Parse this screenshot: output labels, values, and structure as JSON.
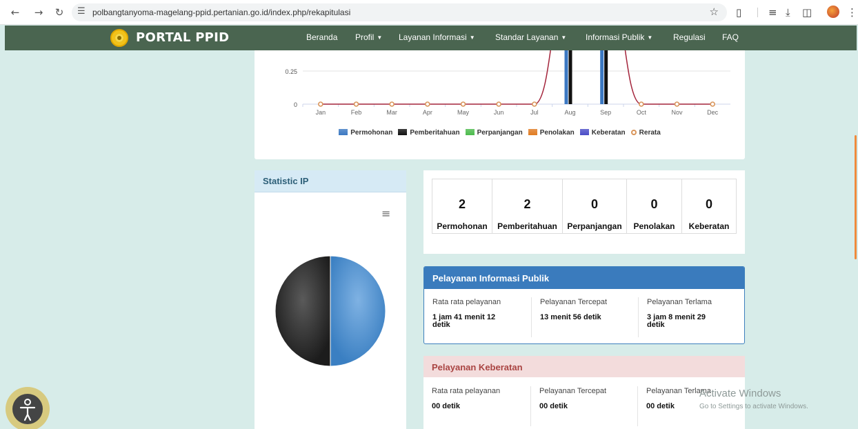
{
  "browser": {
    "url": "polbangtanyoma-magelang-ppid.pertanian.go.id/index.php/rekapitulasi"
  },
  "navbar": {
    "brand": "PORTAL PPID",
    "items": [
      {
        "label": "Beranda",
        "caret": false
      },
      {
        "label": "Profil",
        "caret": true
      },
      {
        "label": "Layanan Informasi",
        "caret": true
      },
      {
        "label": "Standar Layanan",
        "caret": true
      },
      {
        "label": "Informasi Publik",
        "caret": true
      },
      {
        "label": "Regulasi",
        "caret": false
      },
      {
        "label": "FAQ",
        "caret": false
      }
    ]
  },
  "chart_data": {
    "type": "bar",
    "categories": [
      "Jan",
      "Feb",
      "Mar",
      "Apr",
      "May",
      "Jun",
      "Jul",
      "Aug",
      "Sep",
      "Oct",
      "Nov",
      "Dec"
    ],
    "y_ticks_visible": [
      "0.25",
      "0"
    ],
    "ylim": [
      0,
      1
    ],
    "series": [
      {
        "name": "Permohonan",
        "type": "bar",
        "color": "#3b78c2",
        "values": [
          0,
          0,
          0,
          0,
          0,
          0,
          0,
          1,
          1,
          0,
          0,
          0
        ]
      },
      {
        "name": "Pemberitahuan",
        "type": "bar",
        "color": "#111111",
        "values": [
          0,
          0,
          0,
          0,
          0,
          0,
          0,
          1,
          1,
          0,
          0,
          0
        ]
      },
      {
        "name": "Perpanjangan",
        "type": "bar",
        "color": "#4cbb4c",
        "values": [
          0,
          0,
          0,
          0,
          0,
          0,
          0,
          0,
          0,
          0,
          0,
          0
        ]
      },
      {
        "name": "Penolakan",
        "type": "bar",
        "color": "#e07b22",
        "values": [
          0,
          0,
          0,
          0,
          0,
          0,
          0,
          0,
          0,
          0,
          0,
          0
        ]
      },
      {
        "name": "Keberatan",
        "type": "bar",
        "color": "#4a4cc7",
        "values": [
          0,
          0,
          0,
          0,
          0,
          0,
          0,
          0,
          0,
          0,
          0,
          0
        ]
      },
      {
        "name": "Rerata",
        "type": "line",
        "color": "#a3233a",
        "marker_color": "#d9955a",
        "values": [
          0,
          0,
          0,
          0,
          0,
          0,
          0,
          1,
          1,
          0,
          0,
          0
        ]
      }
    ],
    "legend_position": "bottom"
  },
  "statistic_ip": {
    "title": "Statistic IP",
    "chart_data": {
      "type": "pie",
      "slices": [
        {
          "share": 0.5,
          "color": "#3a7fc2"
        },
        {
          "share": 0.5,
          "color": "#1c1c1c"
        }
      ]
    }
  },
  "summary": [
    {
      "count": "2",
      "label": "Permohonan"
    },
    {
      "count": "2",
      "label": "Pemberitahuan"
    },
    {
      "count": "0",
      "label": "Perpanjangan"
    },
    {
      "count": "0",
      "label": "Penolakan"
    },
    {
      "count": "0",
      "label": "Keberatan"
    }
  ],
  "pelayanan_informasi": {
    "title": "Pelayanan Informasi Publik",
    "columns": [
      {
        "label": "Rata rata pelayanan",
        "value_line1": "1 jam 41 menit 12",
        "value_line2": "detik"
      },
      {
        "label": "Pelayanan Tercepat",
        "value_line1": "13 menit 56 detik",
        "value_line2": ""
      },
      {
        "label": "Pelayanan Terlama",
        "value_line1": "3 jam 8 menit 29",
        "value_line2": "detik"
      }
    ]
  },
  "pelayanan_keberatan": {
    "title": "Pelayanan Keberatan",
    "columns": [
      {
        "label": "Rata rata pelayanan",
        "value_line1": "00 detik",
        "value_line2": ""
      },
      {
        "label": "Pelayanan Tercepat",
        "value_line1": "00 detik",
        "value_line2": ""
      },
      {
        "label": "Pelayanan Terlama",
        "value_line1": "00 detik",
        "value_line2": ""
      }
    ]
  },
  "watermark": {
    "title": "Activate Windows",
    "subtitle": "Go to Settings to activate Windows."
  },
  "icons": [
    "back-arrow-icon",
    "forward-arrow-icon",
    "reload-icon",
    "site-settings-icon",
    "bookmark-star-icon",
    "extensions-icon",
    "media-list-icon",
    "download-icon",
    "side-panel-icon",
    "profile-avatar-icon",
    "kebab-menu-icon",
    "chart-menu-icon",
    "accessibility-icon"
  ]
}
